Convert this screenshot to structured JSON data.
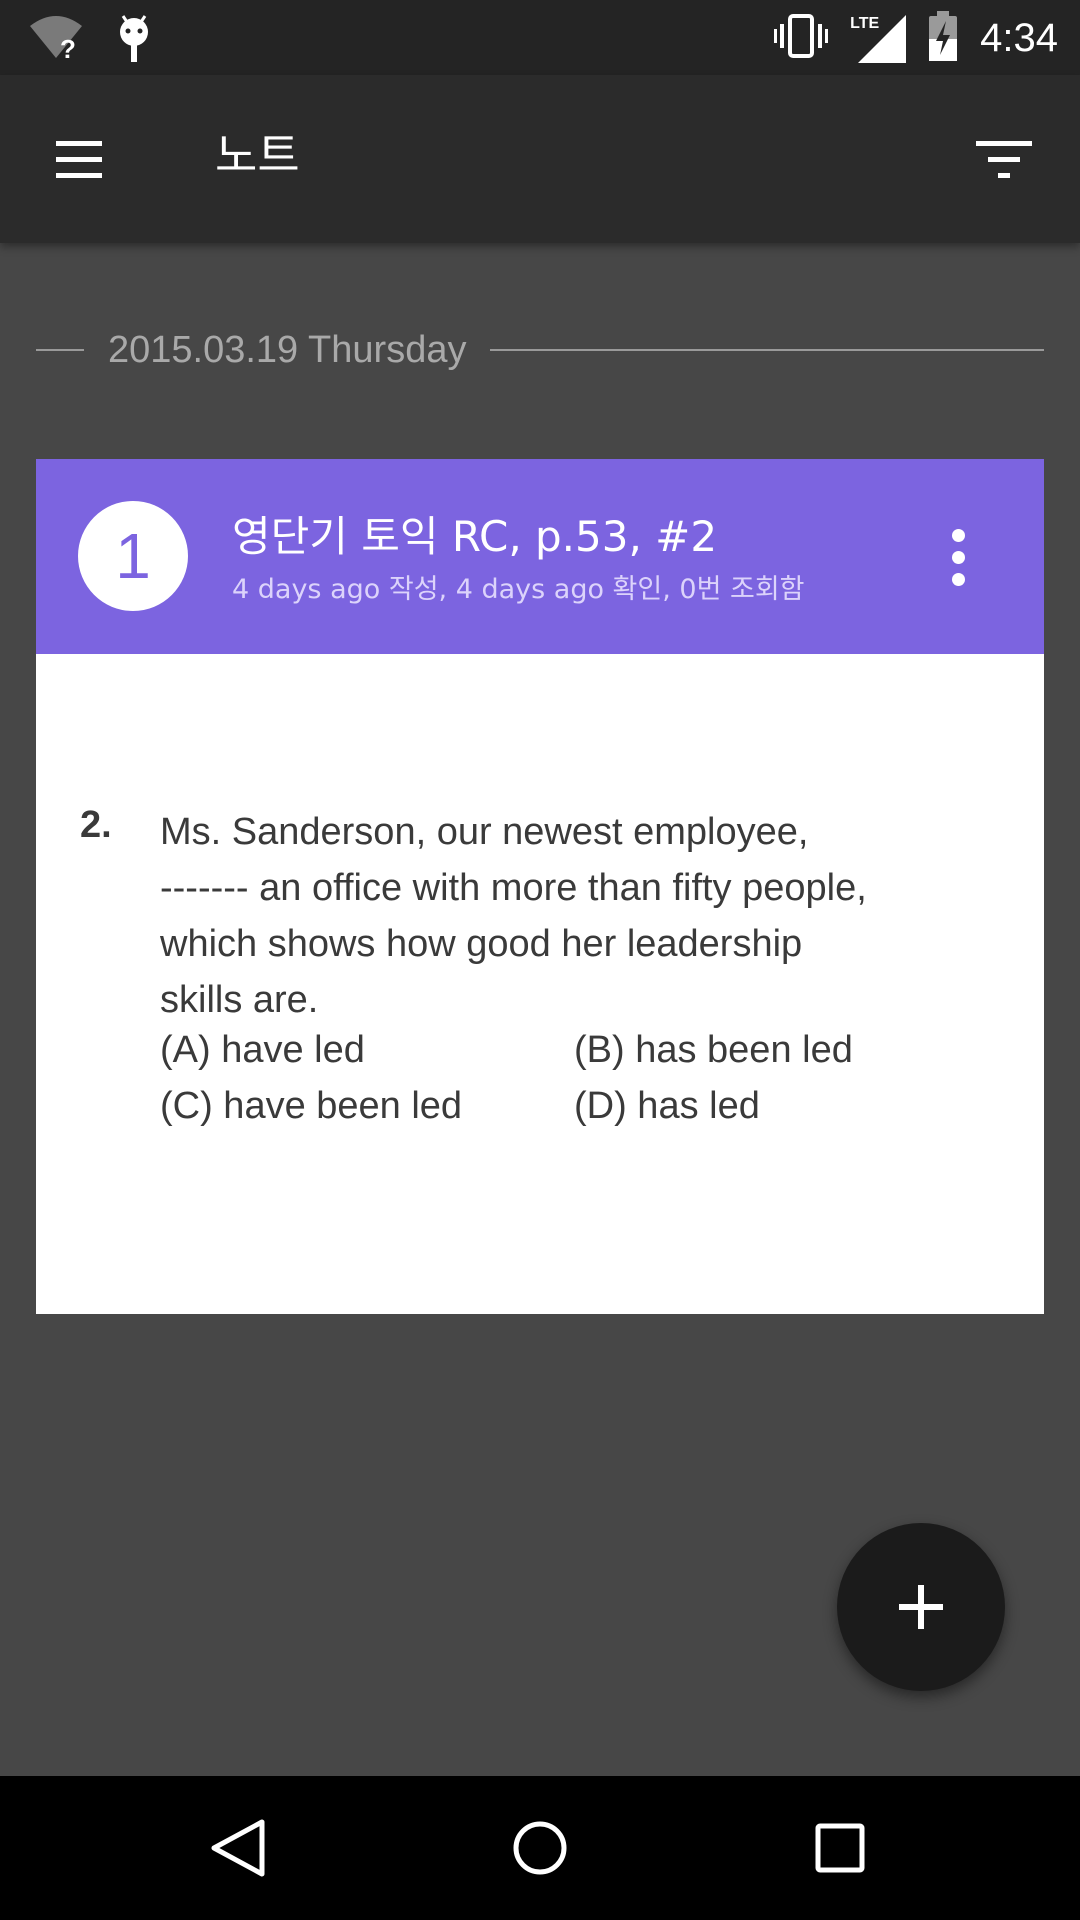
{
  "status_bar": {
    "time": "4:34",
    "icons": [
      "wifi-unknown-icon",
      "android-debug-icon",
      "vibrate-icon",
      "lte-signal-icon",
      "battery-charging-icon"
    ],
    "lte_label": "LTE"
  },
  "app_bar": {
    "title": "노트",
    "icons": [
      "menu-icon",
      "filter-icon"
    ]
  },
  "date_group": {
    "label": "2015.03.19 Thursday"
  },
  "note_card": {
    "badge_number": "1",
    "title": "영단기 토익 RC, p.53, #2",
    "subtitle": "4 days ago 작성, 4 days ago 확인, 0번 조회함",
    "header_color": "#7c64e0",
    "question": {
      "number": "2.",
      "lines": [
        "Ms. Sanderson, our newest employee,",
        "------- an office with more than fifty people,",
        "which shows how good her leadership",
        "skills are."
      ],
      "options": {
        "a": "(A) have led",
        "b": "(B) has been led",
        "c": "(C) have been led",
        "d": "(D) has led"
      }
    }
  },
  "fab": {
    "icon": "plus-icon"
  },
  "nav_bar": {
    "icons": [
      "back-icon",
      "home-icon",
      "recents-icon"
    ]
  }
}
